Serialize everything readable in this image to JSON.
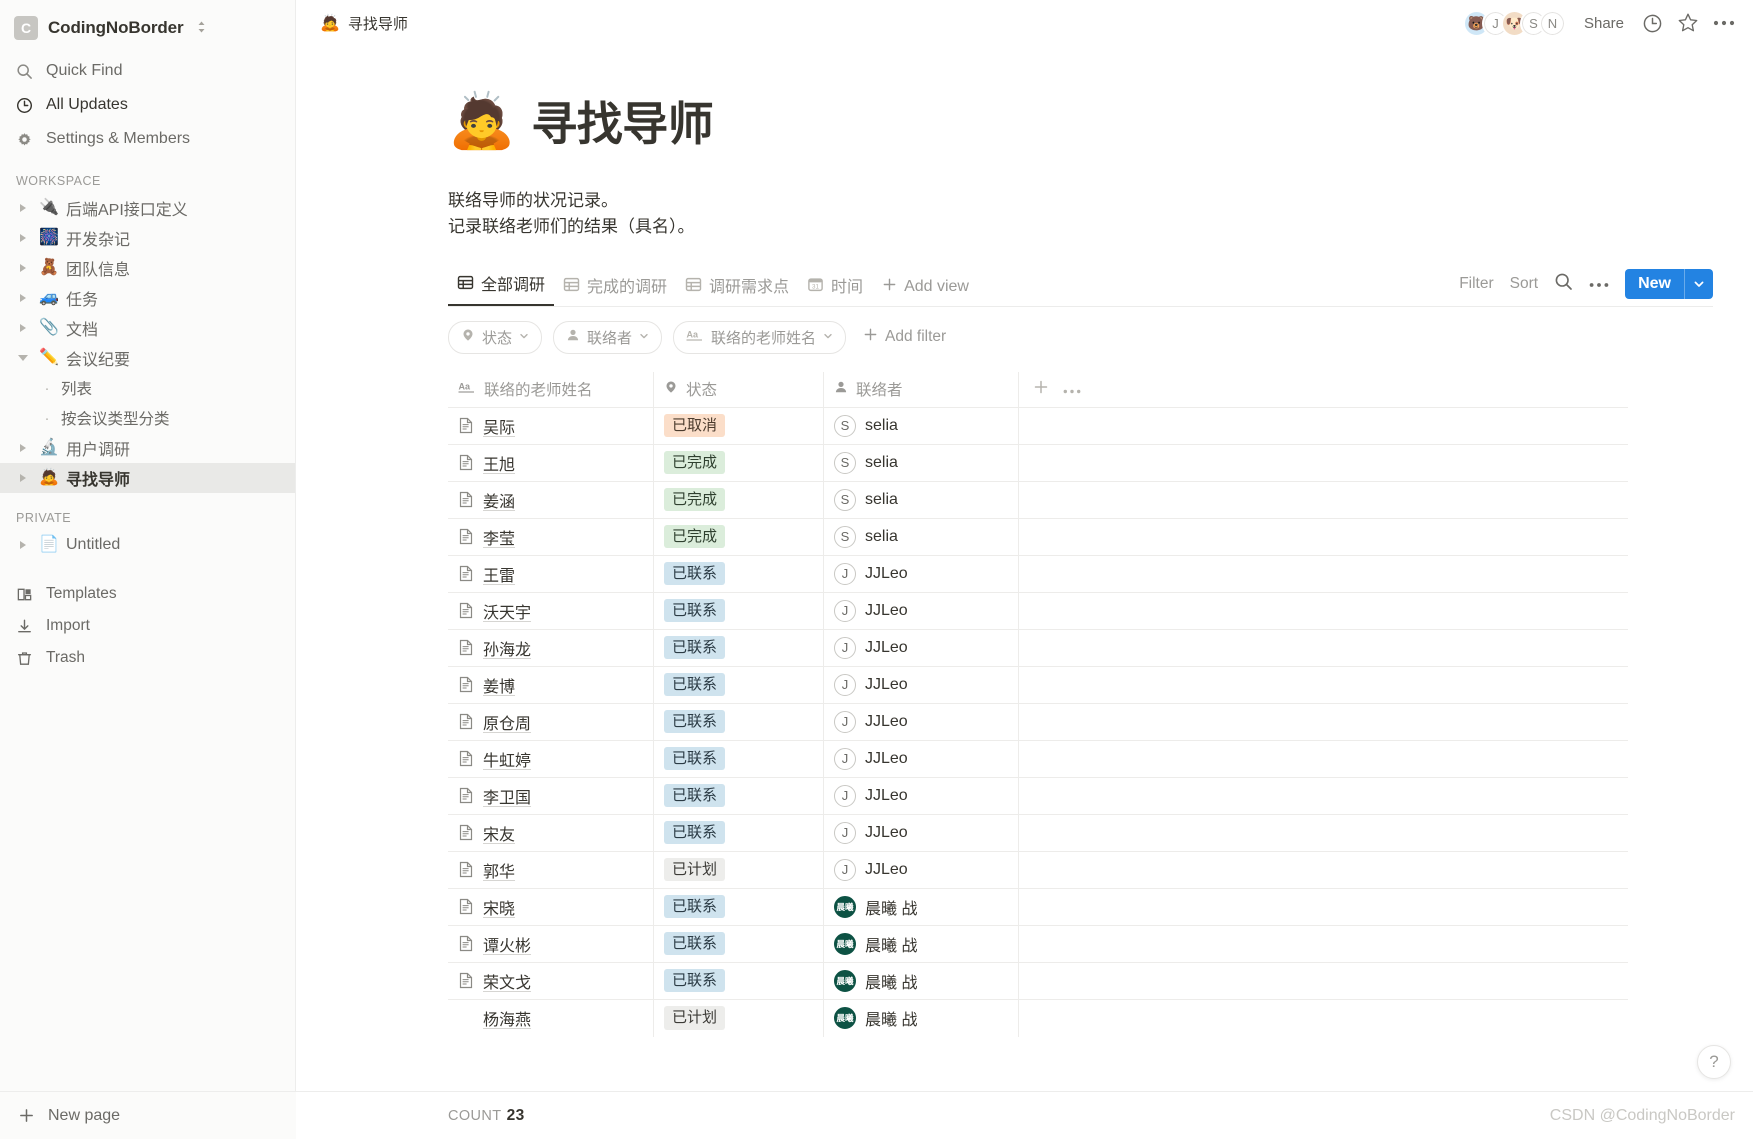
{
  "sidebar": {
    "workspace_name": "CodingNoBorder",
    "workspace_initial": "C",
    "nav": [
      {
        "label": "Quick Find",
        "icon": "search-icon"
      },
      {
        "label": "All Updates",
        "icon": "clock-icon"
      },
      {
        "label": "Settings & Members",
        "icon": "gear-icon"
      }
    ],
    "workspace_label": "WORKSPACE",
    "workspace_items": [
      {
        "label": "后端API接口定义",
        "emoji": "🔌",
        "expanded": false,
        "child": false
      },
      {
        "label": "开发杂记",
        "emoji": "🎆",
        "expanded": false,
        "child": false
      },
      {
        "label": "团队信息",
        "emoji": "🧸",
        "expanded": false,
        "child": false
      },
      {
        "label": "任务",
        "emoji": "🚙",
        "expanded": false,
        "child": false
      },
      {
        "label": "文档",
        "emoji": "📎",
        "expanded": false,
        "child": false
      },
      {
        "label": "会议纪要",
        "emoji": "✏️",
        "expanded": true,
        "child": false
      },
      {
        "label": "列表",
        "emoji": "",
        "expanded": false,
        "child": true
      },
      {
        "label": "按会议类型分类",
        "emoji": "",
        "expanded": false,
        "child": true
      },
      {
        "label": "用户调研",
        "emoji": "🔬",
        "expanded": false,
        "child": false
      },
      {
        "label": "寻找导师",
        "emoji": "🙇",
        "expanded": false,
        "child": false,
        "selected": true
      }
    ],
    "private_label": "PRIVATE",
    "private_items": [
      {
        "label": "Untitled",
        "emoji": "📄",
        "expanded": false,
        "child": false
      }
    ],
    "bottom_items": [
      {
        "label": "Templates",
        "icon": "templates-icon"
      },
      {
        "label": "Import",
        "icon": "import-icon"
      },
      {
        "label": "Trash",
        "icon": "trash-icon"
      }
    ],
    "new_page_label": "New page"
  },
  "topbar": {
    "breadcrumb_emoji": "🙇",
    "breadcrumb_label": "寻找导师",
    "avatars": [
      {
        "initial": "🐻",
        "type": "image-blue"
      },
      {
        "initial": "J",
        "type": "letter"
      },
      {
        "initial": "🐶",
        "type": "image-tan"
      },
      {
        "initial": "S",
        "type": "letter"
      },
      {
        "initial": "N",
        "type": "letter"
      }
    ],
    "share_label": "Share",
    "icons": [
      "clock-icon",
      "star-icon",
      "more-icon"
    ]
  },
  "page": {
    "emoji": "🙇",
    "title": "寻找导师",
    "description_line1": "联络导师的状况记录。",
    "description_line2": "记录联络老师们的结果（具名）。"
  },
  "views": {
    "tabs": [
      {
        "label": "全部调研",
        "icon": "table-icon",
        "active": true
      },
      {
        "label": "完成的调研",
        "icon": "table-icon",
        "active": false
      },
      {
        "label": "调研需求点",
        "icon": "table-icon",
        "active": false
      },
      {
        "label": "时间",
        "icon": "calendar-icon",
        "active": false
      }
    ],
    "add_view_label": "Add view",
    "filter_label": "Filter",
    "sort_label": "Sort",
    "search_icon": "search-icon",
    "more_icon": "more-icon",
    "new_label": "New",
    "new_chevron": "chevron-down-icon"
  },
  "filters": {
    "chips": [
      {
        "label": "状态",
        "icon": "select-icon"
      },
      {
        "label": "联络者",
        "icon": "person-icon"
      },
      {
        "label": "联络的老师姓名",
        "icon": "text-icon"
      }
    ],
    "add_filter_label": "Add filter"
  },
  "table": {
    "columns": [
      {
        "label": "联络的老师姓名",
        "icon": "text-icon"
      },
      {
        "label": "状态",
        "icon": "select-icon"
      },
      {
        "label": "联络者",
        "icon": "person-icon"
      }
    ],
    "add_column_icon": "plus-icon",
    "more_column_icon": "more-icon",
    "rows": [
      {
        "name": "吴际",
        "status": "已取消",
        "status_kind": "cancel",
        "person": "selia",
        "avatar": "S",
        "avatar_kind": "letter"
      },
      {
        "name": "王旭",
        "status": "已完成",
        "status_kind": "done",
        "person": "selia",
        "avatar": "S",
        "avatar_kind": "letter"
      },
      {
        "name": "姜涵",
        "status": "已完成",
        "status_kind": "done",
        "person": "selia",
        "avatar": "S",
        "avatar_kind": "letter"
      },
      {
        "name": "李莹",
        "status": "已完成",
        "status_kind": "done",
        "person": "selia",
        "avatar": "S",
        "avatar_kind": "letter"
      },
      {
        "name": "王雷",
        "status": "已联系",
        "status_kind": "contacted",
        "person": "JJLeo",
        "avatar": "J",
        "avatar_kind": "letter"
      },
      {
        "name": "沃天宇",
        "status": "已联系",
        "status_kind": "contacted",
        "person": "JJLeo",
        "avatar": "J",
        "avatar_kind": "letter"
      },
      {
        "name": "孙海龙",
        "status": "已联系",
        "status_kind": "contacted",
        "person": "JJLeo",
        "avatar": "J",
        "avatar_kind": "letter"
      },
      {
        "name": "姜博",
        "status": "已联系",
        "status_kind": "contacted",
        "person": "JJLeo",
        "avatar": "J",
        "avatar_kind": "letter"
      },
      {
        "name": "原仓周",
        "status": "已联系",
        "status_kind": "contacted",
        "person": "JJLeo",
        "avatar": "J",
        "avatar_kind": "letter"
      },
      {
        "name": "牛虹婷",
        "status": "已联系",
        "status_kind": "contacted",
        "person": "JJLeo",
        "avatar": "J",
        "avatar_kind": "letter"
      },
      {
        "name": "李卫国",
        "status": "已联系",
        "status_kind": "contacted",
        "person": "JJLeo",
        "avatar": "J",
        "avatar_kind": "letter"
      },
      {
        "name": "宋友",
        "status": "已联系",
        "status_kind": "contacted",
        "person": "JJLeo",
        "avatar": "J",
        "avatar_kind": "letter"
      },
      {
        "name": "郭华",
        "status": "已计划",
        "status_kind": "planned",
        "person": "JJLeo",
        "avatar": "J",
        "avatar_kind": "letter"
      },
      {
        "name": "宋晓",
        "status": "已联系",
        "status_kind": "contacted",
        "person": "晨曦 战",
        "avatar": "晨曦",
        "avatar_kind": "green"
      },
      {
        "name": "谭火彬",
        "status": "已联系",
        "status_kind": "contacted",
        "person": "晨曦 战",
        "avatar": "晨曦",
        "avatar_kind": "green"
      },
      {
        "name": "荣文戈",
        "status": "已联系",
        "status_kind": "contacted",
        "person": "晨曦 战",
        "avatar": "晨曦",
        "avatar_kind": "green"
      },
      {
        "name": "杨海燕",
        "status": "已计划",
        "status_kind": "planned",
        "person": "晨曦 战",
        "avatar": "晨曦",
        "avatar_kind": "green"
      }
    ]
  },
  "footer": {
    "count_label": "COUNT",
    "count_value": "23",
    "watermark": "CSDN @CodingNoBorder",
    "help_label": "?"
  },
  "colors": {
    "accent": "#2383e2",
    "sidebar_bg": "#fbfbfa",
    "selected_bg": "#e9e9e7",
    "tag_cancel": "#fbdec9",
    "tag_done": "#dbeddb",
    "tag_contacted": "#cfe3ee",
    "tag_planned": "#ededeb",
    "green_avatar": "#0d5244"
  }
}
